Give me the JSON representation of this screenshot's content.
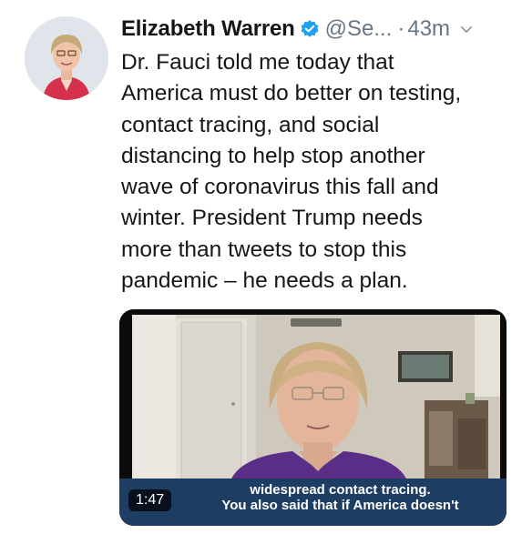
{
  "author": {
    "name": "Elizabeth Warren",
    "handle": "@Se...",
    "separator": "·",
    "time": "43m"
  },
  "tweet": {
    "lines": [
      "Dr. Fauci told me today that",
      "America must do better on testing,",
      "contact tracing, and social",
      "distancing to help stop another",
      "wave of coronavirus this fall and",
      "winter. President Trump needs",
      "more than tweets to stop this",
      "pandemic – he needs a plan."
    ]
  },
  "video": {
    "duration": "1:47",
    "caption_lines": [
      "widespread contact tracing.",
      "You also said that if America doesn't"
    ]
  },
  "icons": {
    "verified": "verified-badge-icon",
    "more": "chevron-down-icon"
  },
  "colors": {
    "text": "#14171a",
    "secondary": "#657786",
    "verified": "#1da1f2",
    "caption_bar": "#1d3d63"
  }
}
